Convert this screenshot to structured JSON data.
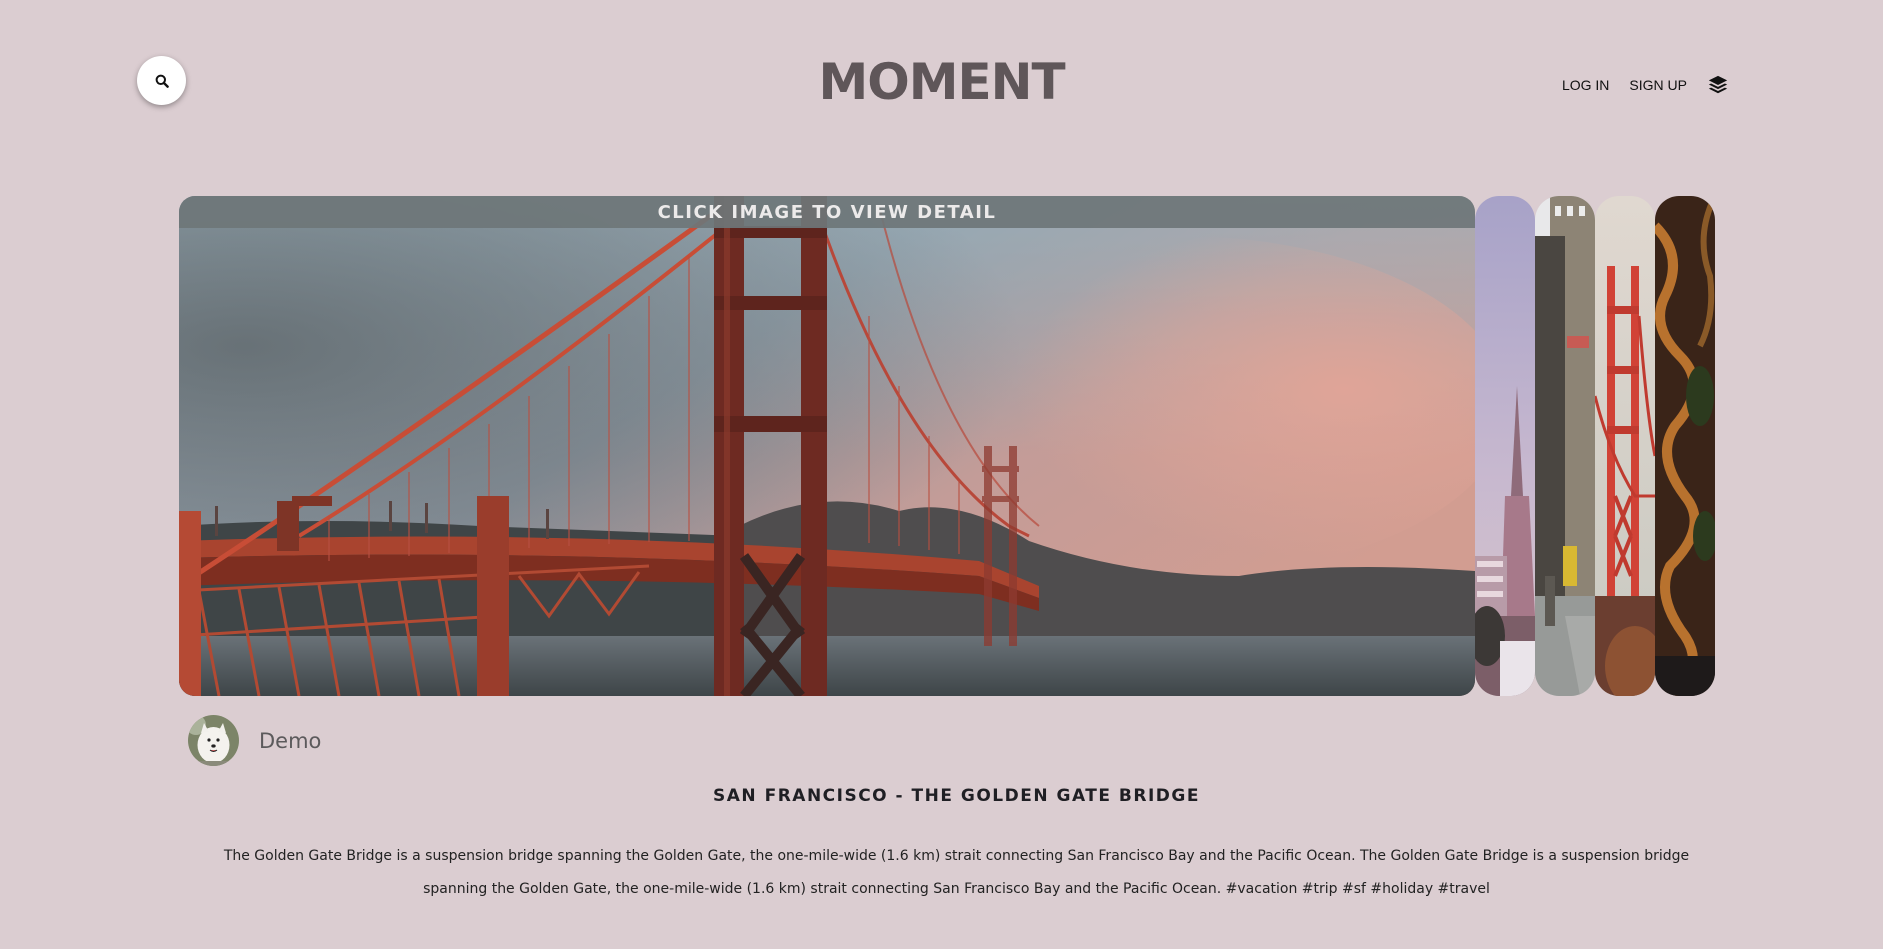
{
  "header": {
    "logo_text": "MOMENT",
    "nav": {
      "login_label": "LOG IN",
      "signup_label": "SIGN UP"
    },
    "icons": {
      "search": "search-icon",
      "layers": "layers-icon"
    }
  },
  "gallery": {
    "overlay_text": "CLICK IMAGE TO VIEW DETAIL",
    "main_image": "golden-gate-bridge-photo",
    "thumbnails": [
      "transamerica-pyramid-photo",
      "city-street-photo",
      "golden-gate-tower-photo",
      "lombard-street-aerial-photo"
    ]
  },
  "author": {
    "name": "Demo",
    "avatar": "samoyed-dog-avatar"
  },
  "post": {
    "title": "SAN FRANCISCO - THE GOLDEN GATE BRIDGE",
    "description": "The Golden Gate Bridge is a suspension bridge spanning the Golden Gate, the one-mile-wide (1.6 km) strait connecting San Francisco Bay and the Pacific Ocean. The Golden Gate Bridge is a suspension bridge spanning the Golden Gate, the one-mile-wide (1.6 km) strait connecting San Francisco Bay and the Pacific Ocean. #vacation #trip #sf #holiday #travel"
  },
  "colors": {
    "background": "#dbcdd1",
    "logo": "#5f5659",
    "bridge_red": "#c4503a"
  }
}
